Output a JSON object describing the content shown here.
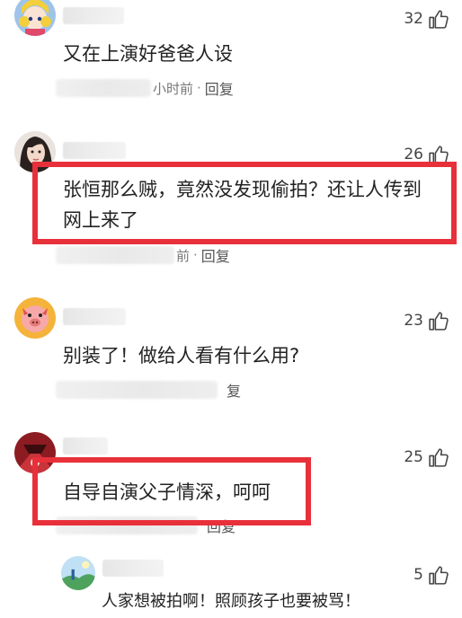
{
  "comments": [
    {
      "likes": "32",
      "text_lines": [
        "又在上演好爸爸人设"
      ],
      "time": "小时前",
      "dot": "·",
      "reply": "回复",
      "avatar": "cartoon-girl-avatar"
    },
    {
      "likes": "26",
      "text_lines": [
        "张恒那么贼，竟然没发现偷拍？还让人传到",
        "网上来了"
      ],
      "time": "前",
      "dot": "·",
      "reply": "回复",
      "avatar": "woman-photo-avatar"
    },
    {
      "likes": "23",
      "text_lines": [
        "别装了！做给人看有什么用?"
      ],
      "time": "",
      "dot": "",
      "reply": "复",
      "avatar": "pig-cartoon-avatar"
    },
    {
      "likes": "25",
      "text_lines": [
        "自导自演父子情深，呵呵"
      ],
      "time": "",
      "dot": "",
      "reply": "回复",
      "avatar": "red-dark-avatar"
    },
    {
      "likes": "5",
      "text_lines": [],
      "time": "",
      "dot": "",
      "reply": "",
      "avatar": "outdoor-scene-avatar"
    }
  ],
  "caption": "人家想被拍啊！照顾孩子也要被骂！",
  "highlight_color": "#e8303a",
  "icons": {
    "like": "thumbs-up-icon"
  }
}
